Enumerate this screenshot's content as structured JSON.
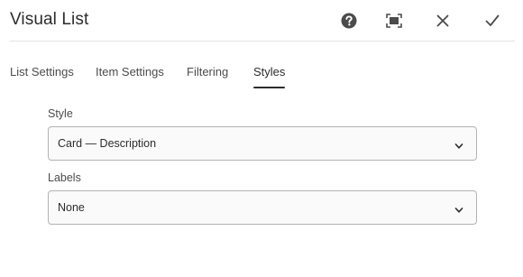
{
  "dialog": {
    "title": "Visual List",
    "actions": {
      "help": "help-icon",
      "fullscreen": "fullscreen-icon",
      "close": "close-icon",
      "done": "checkmark-icon"
    }
  },
  "tabs": [
    {
      "label": "List Settings",
      "active": false
    },
    {
      "label": "Item Settings",
      "active": false
    },
    {
      "label": "Filtering",
      "active": false
    },
    {
      "label": "Styles",
      "active": true
    }
  ],
  "fields": {
    "style": {
      "label": "Style",
      "value": "Card — Description"
    },
    "labels": {
      "label": "Labels",
      "value": "None"
    }
  },
  "colors": {
    "text": "#2c2c2c",
    "muted_text": "#4b4b4b",
    "field_border": "#b3b3b3",
    "field_bg": "#fafafa",
    "divider": "#e3e3e3"
  }
}
